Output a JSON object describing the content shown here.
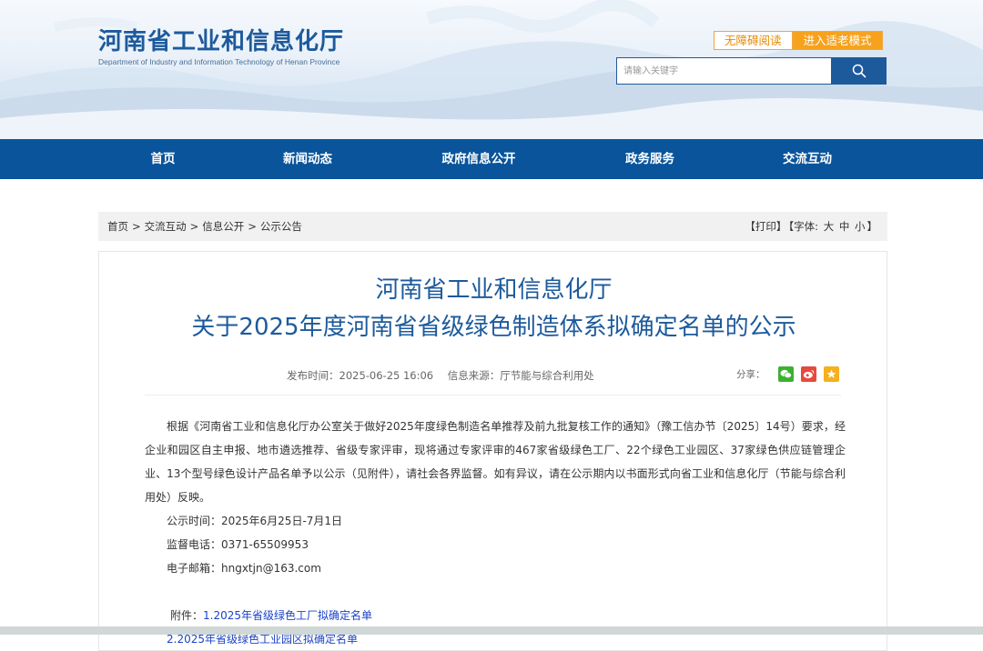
{
  "header": {
    "title_cn": "河南省工业和信息化厅",
    "title_en": "Department of Industry and Information Technology of Henan Province",
    "accessibility_label": "无障碍阅读",
    "elder_mode_label": "进入适老模式",
    "search_placeholder": "请输入关键字"
  },
  "nav": {
    "items": [
      {
        "label": "首页"
      },
      {
        "label": "新闻动态"
      },
      {
        "label": "政府信息公开"
      },
      {
        "label": "政务服务"
      },
      {
        "label": "交流互动"
      }
    ]
  },
  "breadcrumb": {
    "items": [
      "首页",
      "交流互动",
      "信息公开",
      "公示公告"
    ],
    "separator": ">"
  },
  "tools": {
    "print": "【打印】",
    "font_label": "【字体:",
    "large": "大",
    "medium": "中",
    "small": "小",
    "close": "】"
  },
  "article": {
    "title_line1": "河南省工业和信息化厅",
    "title_line2": "关于2025年度河南省省级绿色制造体系拟确定名单的公示",
    "publish_time": "发布时间：2025-06-25 16:06",
    "source": "信息来源：厅节能与综合利用处",
    "share_label": "分享：",
    "lead": "根据《河南省工业和信息化厅办公室关于做好2025年度绿色制造名单推荐及前九批复核工作的通知》（豫工信办节〔2025〕14号）要求，经企业和园区自主申报、地市遴选推荐、省级专家评审，现将通过专家评审的467家省级绿色工厂、22个绿色工业园区、37家绿色供应链管理企业、13个型号绿色设计产品名单予以公示（见附件），请社会各界监督。如有异议，请在公示期内以书面形式向省工业和信息化厅（节能与综合利用处）反映。",
    "period": "公示时间：2025年6月25日-7月1日",
    "phone": "监督电话：0371-65509953",
    "email": "电子邮箱：hngxtjn@163.com",
    "attachment_label": "附件：",
    "attachments": [
      "1.2025年省级绿色工厂拟确定名单",
      "2.2025年省级绿色工业园区拟确定名单"
    ]
  },
  "colors": {
    "brand_blue": "#09549b",
    "title_blue": "#1d5a9c",
    "orange": "#f7a21c",
    "link_blue": "#1d43c8"
  }
}
